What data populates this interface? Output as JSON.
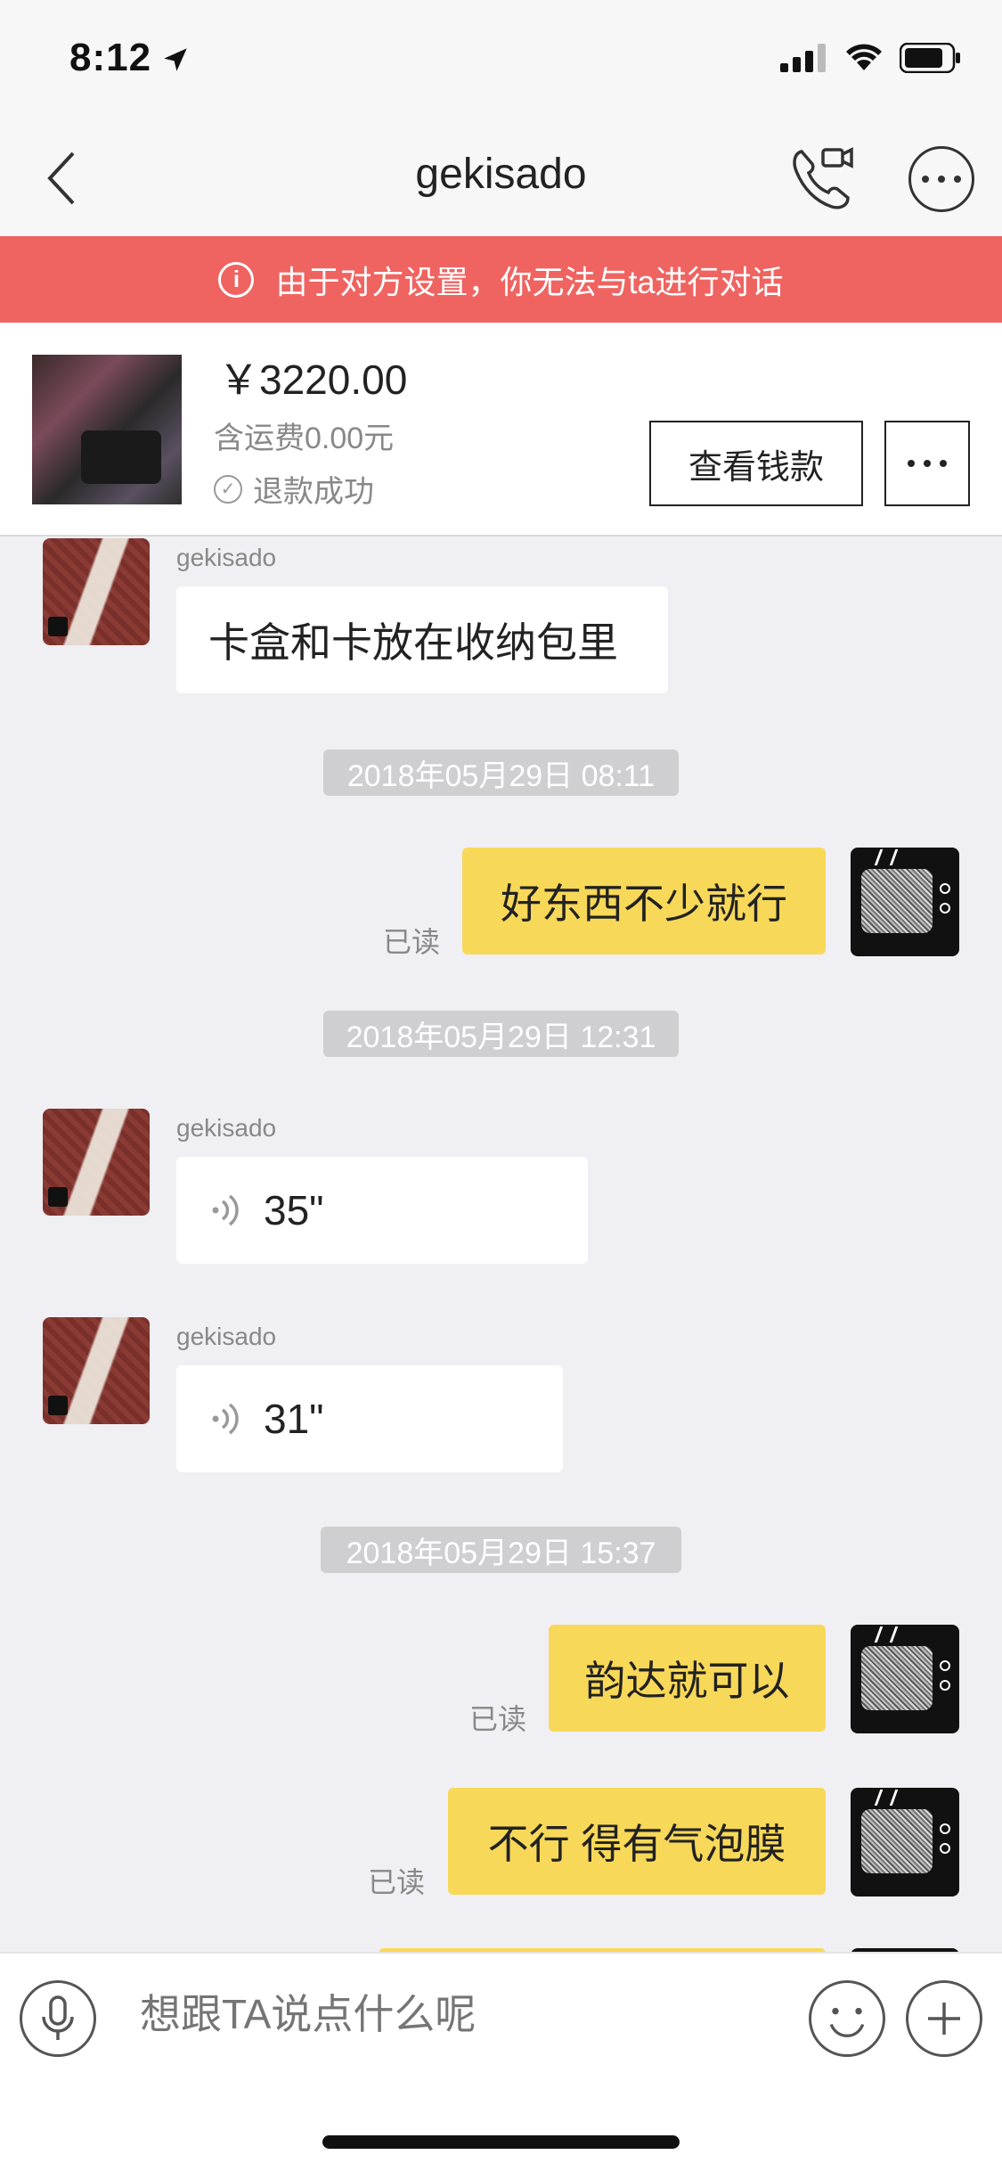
{
  "status_bar": {
    "time": "8:12"
  },
  "nav": {
    "title": "gekisado"
  },
  "warning": {
    "text": "由于对方设置，你无法与ta进行对话"
  },
  "product": {
    "price": "￥3220.00",
    "shipping": "含运费0.00元",
    "status": "退款成功",
    "view_button": "查看钱款"
  },
  "messages": [
    {
      "sender": "gekisado",
      "text": "卡盒和卡放在收纳包里"
    },
    {
      "timestamp": "2018年05月29日 08:11"
    },
    {
      "text": "好东西不少就行",
      "read": "已读"
    },
    {
      "timestamp": "2018年05月29日 12:31"
    },
    {
      "sender": "gekisado",
      "voice": "35\""
    },
    {
      "sender": "gekisado",
      "voice": "31\""
    },
    {
      "timestamp": "2018年05月29日 15:37"
    },
    {
      "text": "韵达就可以",
      "read": "已读"
    },
    {
      "text": "不行 得有气泡膜",
      "read": "已读"
    }
  ],
  "input": {
    "placeholder": "想跟TA说点什么呢"
  },
  "colors": {
    "banner": "#ef6461",
    "own_bubble": "#f8d858",
    "background": "#efeff4"
  },
  "icons": [
    "back-icon",
    "video-phone-icon",
    "more-icon",
    "info-icon",
    "check-icon",
    "voice-icon",
    "mic-icon",
    "emoji-icon",
    "plus-icon"
  ]
}
